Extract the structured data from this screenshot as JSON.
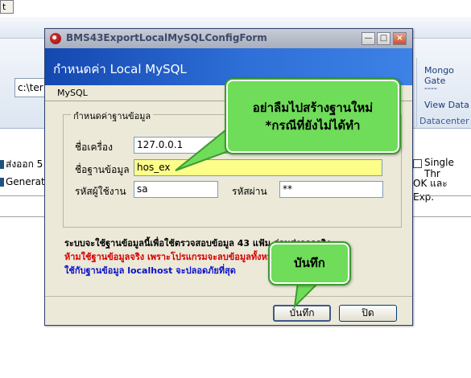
{
  "background": {
    "top_button_label": "t",
    "path_value": "c:\\ter",
    "datacenter_items": [
      "Mongo Gate",
      "----",
      "View Data"
    ],
    "datacenter_label": "Datacenter",
    "row1_text": "ส่งออก 5",
    "row1_right": "Single Thr",
    "row2_text": "Generate",
    "row2_right": "OK และ Exp."
  },
  "dialog": {
    "window_title": "BMS43ExportLocalMySQLConfigForm",
    "header_title": "กำหนดค่า Local MySQL",
    "tab_label": "MySQL",
    "group_title": "กำหนดค่าฐานข้อมูล",
    "fields": {
      "host_label": "ชื่อเครื่อง",
      "host_value": "127.0.0.1",
      "db_label": "ชื่อฐานข้อมูล",
      "db_value": "hos_ex",
      "user_label": "รหัสผู้ใช้งาน",
      "user_value": "sa",
      "pass_label": "รหัสผ่าน",
      "pass_value": "**"
    },
    "notes": {
      "line1": "ระบบจะใช้ฐานข้อมูลนี้เพื่อใช้ตรวจสอบข้อมูล 43 แฟ้ม ก่อนส่งออกจริง",
      "line2": "ห้ามใช้ฐานข้อมูลจริง เพราะโปรแกรมจะลบข้อมูลทั้งหมดก่อนส่งออก",
      "line3": "ใช้กับฐานข้อมูล localhost จะปลอดภัยที่สุด"
    },
    "buttons": {
      "save": "บันทึก",
      "close": "ปิด"
    }
  },
  "annotations": {
    "callout_top_line1": "อย่าลืมไปสร้างฐานใหม่",
    "callout_top_line2": "*กรณีที่ยังไม่ได้ทำ",
    "callout_bottom": "บันทึก"
  },
  "colors": {
    "note_line1": "#000000",
    "note_line2": "#d40000",
    "note_line3": "#0a10c8",
    "highlight_field": "#fdfd8a",
    "callout_fill": "#6fdc5a"
  }
}
